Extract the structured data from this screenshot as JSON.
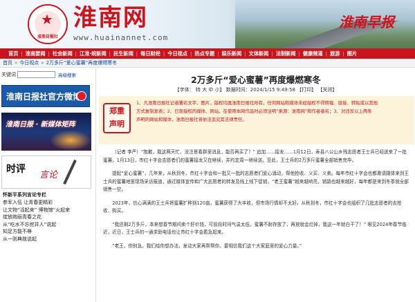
{
  "header": {
    "emblem_text": "淮南日报社",
    "site_name": "淮南网",
    "site_url": "www.huainannet.com",
    "newspaper_name": "淮南早报"
  },
  "nav": {
    "items": [
      "首页",
      "淮南要闻",
      "社会新闻",
      "江淮·皖新闻",
      "民生新闻",
      "每日财经",
      "今日视点",
      "热点专题",
      "娱乐新闻",
      "文体新闻",
      "法制新闻",
      "健康频道",
      "旅游",
      "图片"
    ]
  },
  "breadcrumb": {
    "home": "首页",
    "section": "今日视点",
    "current": "2万多斤“爱心蜜薯”再度爆燃寒冬"
  },
  "sidebar": {
    "keyword_label": "关键词",
    "keyword_value": "",
    "advanced_search": "高级搜索",
    "weibo_banner": "淮南日报社官方微博",
    "cyber_banner": "淮南日报 · 新媒体矩阵",
    "comment_banner_title": "时评",
    "comment_banner_sub": "言论",
    "list_head": "怀新平系列言论专栏",
    "list_items": [
      "参军入伍 让青春更精彩",
      "让文物“活起来” 博物馆“火起来",
      "绽放绚丽青春之花",
      "从“吃水不忘挖井人”说起",
      "知足方能不辱",
      "从一则典故说起"
    ]
  },
  "article": {
    "title": "2万多斤“爱心蜜薯”再度爆燃寒冬",
    "font_label": "【字体：",
    "font_sizes": [
      "特",
      "大",
      "中",
      "小"
    ],
    "font_close": "】",
    "date_time": "数据时间：2024/1/15 9:49:58",
    "print": "【打印】",
    "close": "【关闭】",
    "notice_stamp_1": "郑重",
    "notice_stamp_2": "声明",
    "notice_lines": [
      "1、凡淮南日报社记者署名文字、图片，版权均属淮南日报社所有，任何网站和媒体未经授权不得转载、链接、转贴或以其他",
      "方式复制发表；2、已获授权的媒体、网站，在使用本网作品时必须注明“来源：淮南网”和作者者名；3、对违反以上两条",
      "声明的网站和媒体，淮南日报社将依法追究其法律责任。"
    ],
    "paragraphs": [
      "（记者 李严）“抱歉，我这两天忙，没注意看群里消息，能否再买了？” 追加……接龙……1月12日，寿县八公山乡残志愿者王士兵已经送来了一批蜜薯，1月13日，市红十字会志愿者们的蜜薯接龙又在继续，并约定周一继续送。至此，王士兵的2万多斤蜜薯全部销售完毕。",
      "提起“爱心蜜薯”，几年来，从秋到冬，市红十字会和一批又一批的志愿者们爱心涌动，帮他抢收、义买、义卖。每年市红十字会也都邀请媒体来到王士兵的蜜薯地里现场采访报道，通过媒体宣传和广大志愿者的转发及线上线下促销，“老王蜜薯”越来越响亮，销路也越来越好，每年都是来到冬季就全部销售一空。",
      "2023年，信心满满的王士兵将蜜薯扩种到120亩，蜜薯获得了大丰收，但市场行情却不太好。从秋到冬，市红十字会也组织了几批志愿者的去抢收、购买。",
      "“我还剩2万多斤，本来想春节期间卖个好价钱，可前段时间气温太低，蜜薯不耐存放了，再放就会烂掉，我这一年就白干了！” 眼见2024年春节临近，近日，王士兵的一通求助电话也让市红十字会着急起来。",
      "“老王，你别急，我们给你想办法，发动大家再帮帮你，要相信我们这个大家庭里的爱心力量。”"
    ]
  },
  "colors": {
    "brand_red": "#c8151d",
    "link_blue": "#0a47a0",
    "notice_bg": "#fdf3da"
  }
}
